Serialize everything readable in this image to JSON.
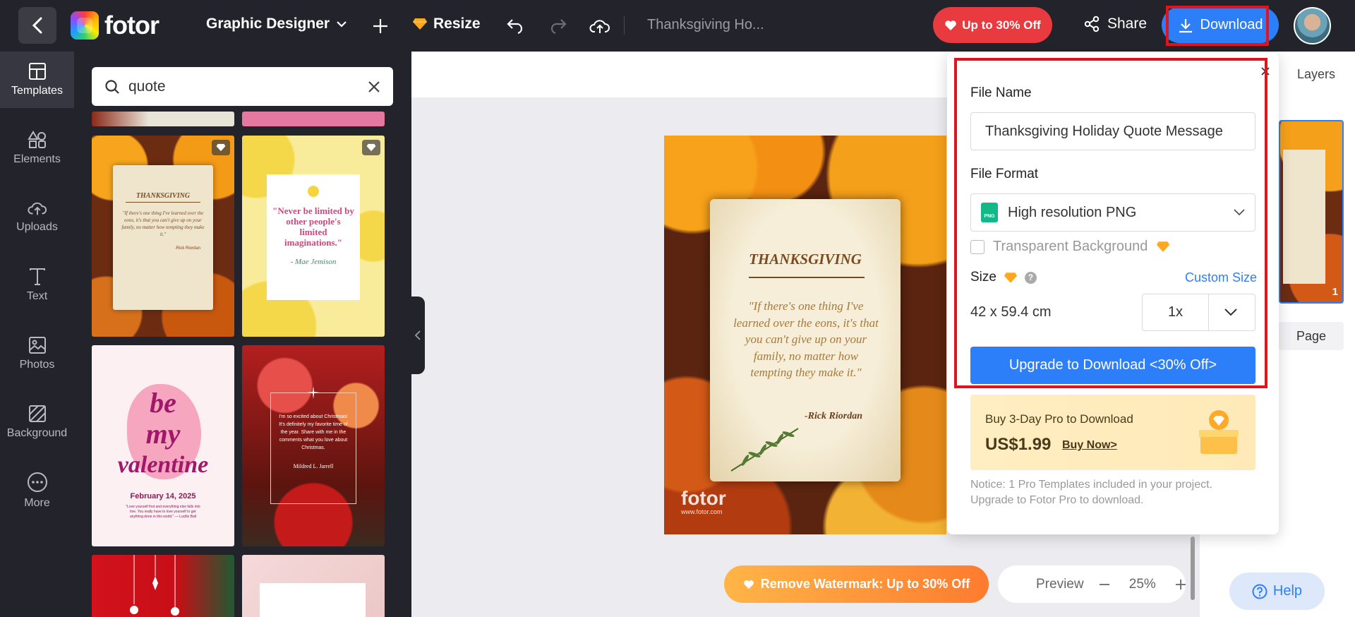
{
  "topbar": {
    "logo_text": "fotor",
    "project_type": "Graphic Designer",
    "resize_label": "Resize",
    "doc_title": "Thanksgiving Ho...",
    "promo_label": "Up to 30% Off",
    "share_label": "Share",
    "download_label": "Download"
  },
  "sidebar": {
    "items": [
      {
        "label": "Templates"
      },
      {
        "label": "Elements"
      },
      {
        "label": "Uploads"
      },
      {
        "label": "Text"
      },
      {
        "label": "Photos"
      },
      {
        "label": "Background"
      },
      {
        "label": "More"
      }
    ]
  },
  "search": {
    "value": "quote"
  },
  "templates": {
    "t1": {
      "heading": "THANKSGIVING",
      "quote": "\"If there's one thing I've learned over the eons, it's that you can't give up on your family, no matter how tempting they make it.\"",
      "author": "-Rick Riordan"
    },
    "t2": {
      "quote": "\"Never be limited by other people's limited imaginations.\"",
      "author": "- Mae Jemison"
    },
    "t3": {
      "line1": "be",
      "line2": "my",
      "line3": "valentine",
      "date": "February 14, 2025",
      "small": "\"Love yourself first and everything else falls into line. You really have to love yourself to get anything done in this world.\" — Lucille Ball"
    },
    "t4": {
      "text": "I'm so excited about Christmas! It's definitely my favorite time of the year. Share with me in the comments what you love about Christmas.",
      "author": "Mildred L. Jarrell"
    }
  },
  "artboard": {
    "heading": "THANKSGIVING",
    "quote": "\"If there's one thing I've learned over the eons, it's that you can't give up on your family, no matter how tempting they make it.\"",
    "author": "-Rick Riordan",
    "watermark": "fotor",
    "watermark_url": "www.fotor.com"
  },
  "rightpanel": {
    "layers_label": "Layers",
    "page_number": "1",
    "add_page": "Page"
  },
  "download_popup": {
    "file_name_label": "File Name",
    "file_name_value": "Thanksgiving Holiday Quote Message",
    "file_format_label": "File Format",
    "format_badge": "PNG",
    "format_value": "High resolution PNG",
    "transparent_label": "Transparent Background",
    "size_label": "Size",
    "custom_size": "Custom Size",
    "size_value": "42 x 59.4 cm",
    "scale_value": "1x",
    "upgrade_button": "Upgrade to Download <30% Off>",
    "buy_title": "Buy 3-Day Pro to Download",
    "buy_price": "US$1.99",
    "buy_now": "Buy Now>",
    "notice": "Notice: 1 Pro Templates included in your project. Upgrade to Fotor Pro to download."
  },
  "bottom": {
    "watermark_promo": "Remove Watermark: Up to 30% Off",
    "preview_label": "Preview",
    "zoom": "25%",
    "help_label": "Help"
  },
  "colors": {
    "accent": "#2d7ff9",
    "dark": "#23242b",
    "promo_red": "#e93b3f",
    "highlight": "#e0141a"
  }
}
